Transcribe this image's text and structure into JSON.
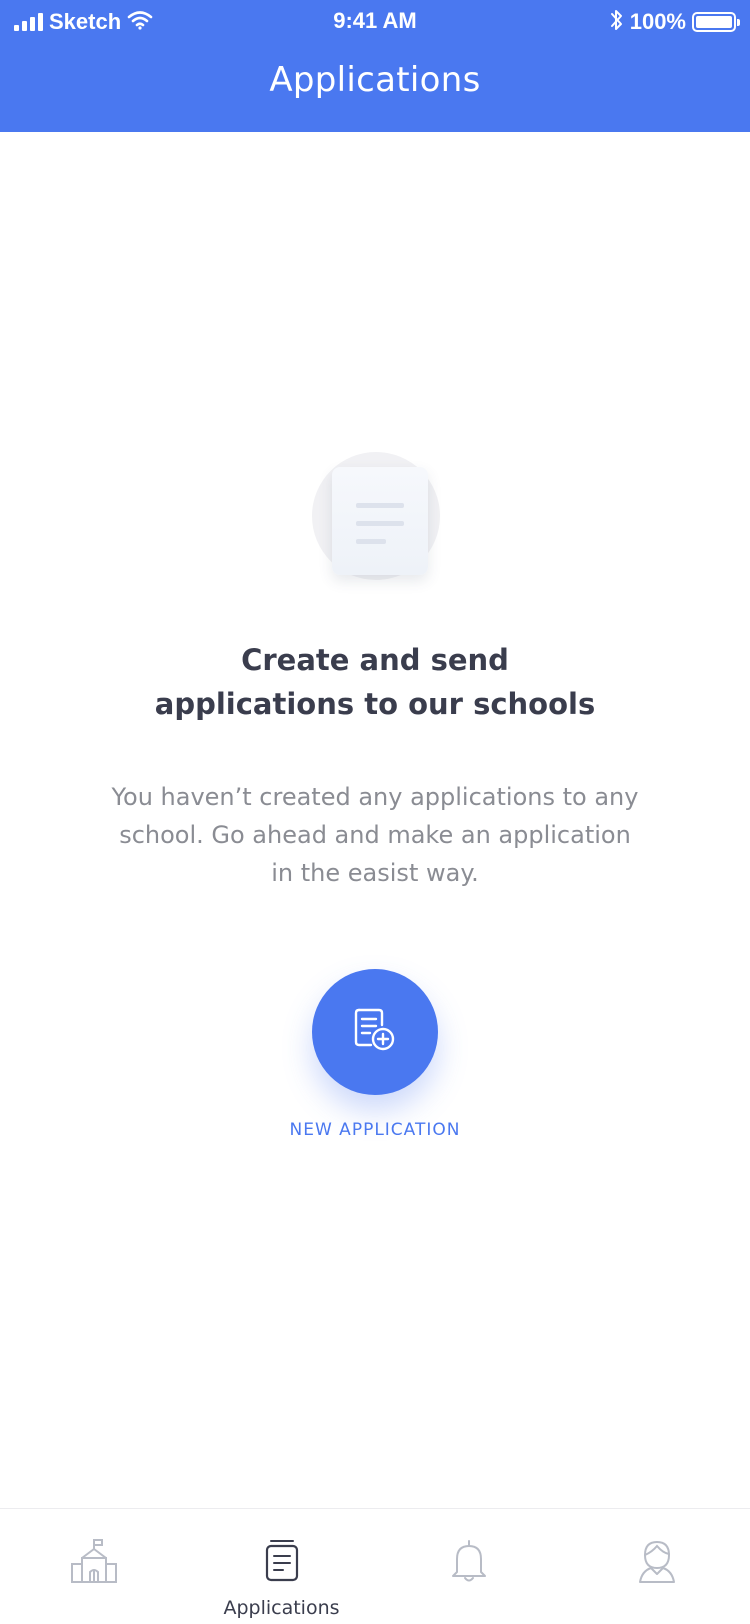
{
  "status_bar": {
    "carrier": "Sketch",
    "time": "9:41 AM",
    "battery": "100%"
  },
  "header": {
    "title": "Applications"
  },
  "empty_state": {
    "headline_line1": "Create and send",
    "headline_line2": "applications to our schools",
    "description_line1": "You haven’t created any applications to any",
    "description_line2": "school. Go ahead and make an application",
    "description_line3": "in the easist way."
  },
  "fab": {
    "label": "NEW APPLICATION"
  },
  "tabbar": {
    "tabs": [
      {
        "icon": "school-icon",
        "label": "",
        "active": false
      },
      {
        "icon": "document-icon",
        "label": "Applications",
        "active": true
      },
      {
        "icon": "bell-icon",
        "label": "",
        "active": false
      },
      {
        "icon": "profile-icon",
        "label": "",
        "active": false
      }
    ]
  },
  "colors": {
    "primary": "#4a78f0",
    "heading": "#3a3d4d",
    "body_text": "#8a8c93",
    "inactive_icon": "#b8bcc6"
  }
}
